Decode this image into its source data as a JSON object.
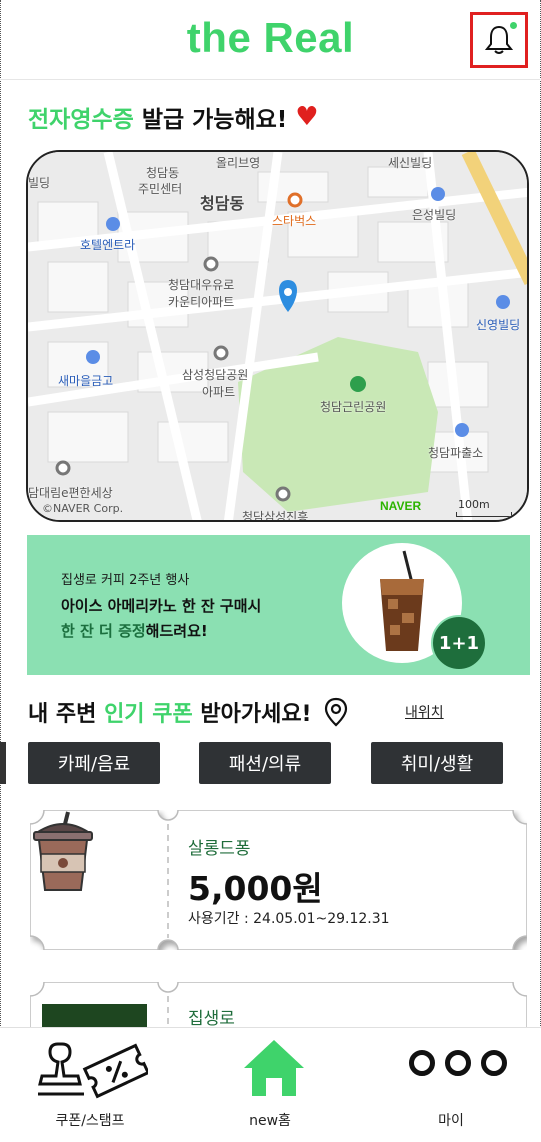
{
  "header": {
    "logo": "the Real",
    "bell_icon": "bell-icon",
    "notification_dot": true
  },
  "receipt": {
    "highlight": "전자영수증",
    "text": "발급 가능해요!",
    "icon": "heart-icon"
  },
  "map": {
    "labels": {
      "l1": "청담동",
      "l2": "주민센터",
      "l3": "올리브영",
      "l4": "세신빌딩",
      "l5": "빌딩",
      "l6": "청담동",
      "l7": "스타벅스",
      "l8": "은성빌딩",
      "l9": "호텔엔트라",
      "l10": "청담대우유로",
      "l11": "카운티아파트",
      "l12": "신영빌딩",
      "l13": "새마을금고",
      "l14": "삼성청담공원",
      "l15": "아파트",
      "l16": "청담근린공원",
      "l17": "청담파출소",
      "l18": "담대림e편한세상",
      "l19": "청담삼성진흥"
    },
    "provider": "NAVER",
    "copyright": "©NAVER Corp.",
    "scale": "100m"
  },
  "promo": {
    "subtitle": "집생로 커피 2주년 행사",
    "line1": "아이스 아메리카노 한 잔 구매시",
    "line2_highlight": "한 잔 더 증정",
    "line2_rest": "해드려요!",
    "badge": "1+1"
  },
  "nearby": {
    "prefix": "내 주변",
    "highlight": "인기 쿠폰",
    "suffix": "받아가세요!",
    "location_link": "내위치"
  },
  "categories": [
    "카페/음료",
    "패션/의류",
    "취미/생활"
  ],
  "coupons": [
    {
      "store": "살롱드퐁",
      "amount": "5,000원",
      "period": "사용기간 : 24.05.01~29.12.31"
    },
    {
      "store": "집생로"
    }
  ],
  "bottom_nav": {
    "coupon_stamp": "쿠폰/스탬프",
    "home": "new홈",
    "my": "마이"
  },
  "colors": {
    "brand_green": "#3fd36b",
    "promo_bg": "#8be0b2",
    "dark_button": "#2f3235",
    "alert_red": "#e02020"
  }
}
